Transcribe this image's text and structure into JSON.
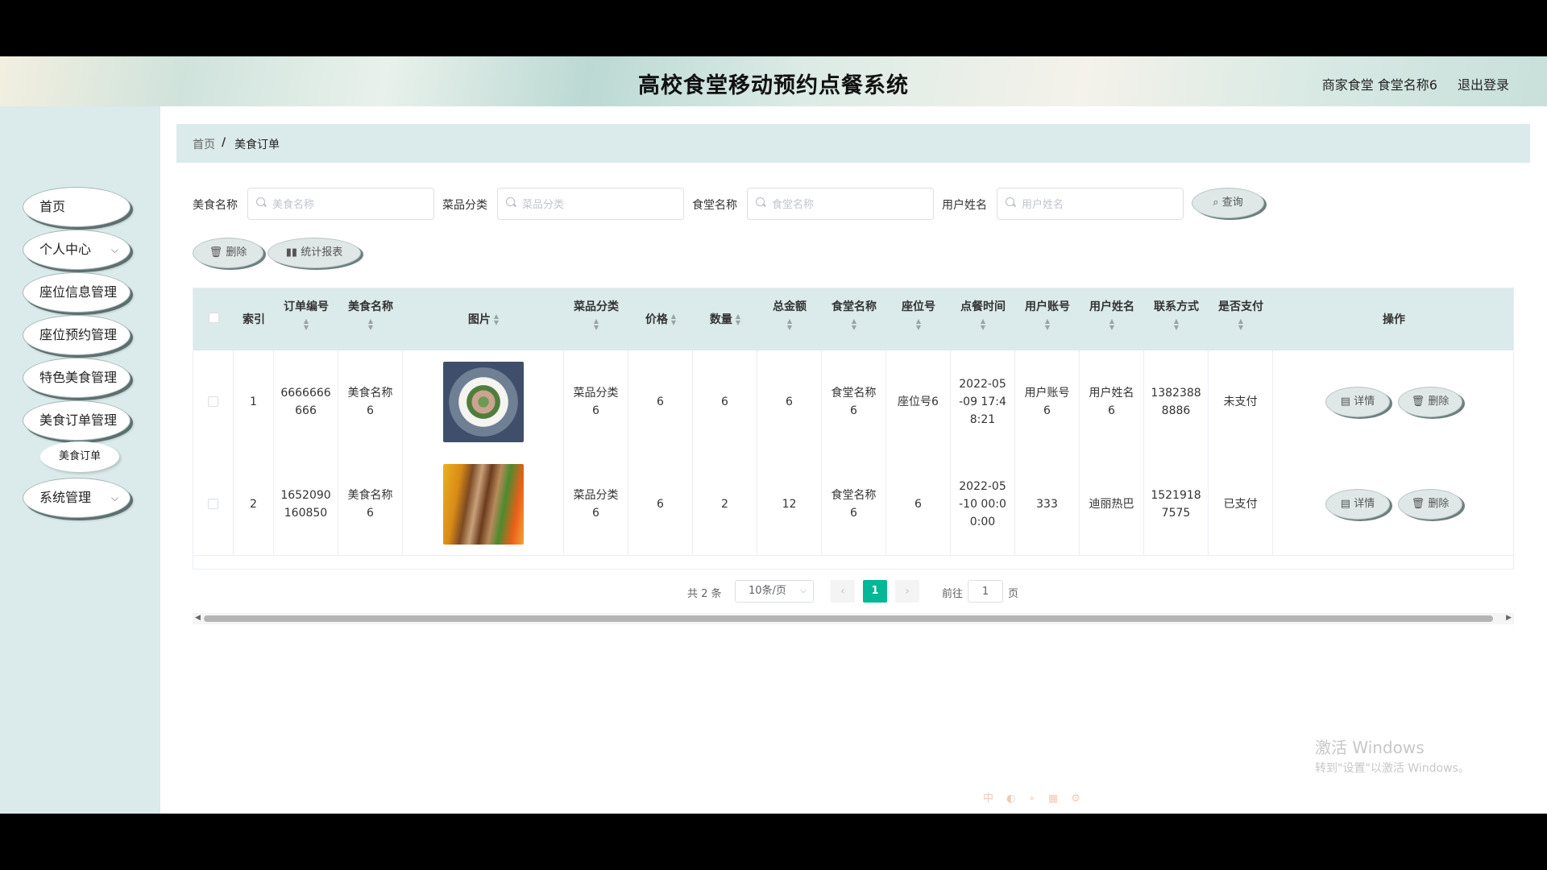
{
  "header": {
    "title": "高校食堂移动预约点餐系统",
    "user": "商家食堂 食堂名称6",
    "logout": "退出登录"
  },
  "sidebar": {
    "items": [
      {
        "label": "首页",
        "has_submenu": false
      },
      {
        "label": "个人中心",
        "has_submenu": true
      },
      {
        "label": "座位信息管理",
        "has_submenu": false
      },
      {
        "label": "座位预约管理",
        "has_submenu": false
      },
      {
        "label": "特色美食管理",
        "has_submenu": false
      },
      {
        "label": "美食订单管理",
        "has_submenu": false
      },
      {
        "label": "系统管理",
        "has_submenu": true
      }
    ],
    "submenu": [
      {
        "label": "美食订单"
      }
    ]
  },
  "breadcrumb": {
    "home": "首页",
    "separator": "/",
    "current": "美食订单"
  },
  "search": {
    "fields": [
      {
        "label": "美食名称",
        "placeholder": "美食名称",
        "value": ""
      },
      {
        "label": "菜品分类",
        "placeholder": "菜品分类",
        "value": ""
      },
      {
        "label": "食堂名称",
        "placeholder": "食堂名称",
        "value": ""
      },
      {
        "label": "用户姓名",
        "placeholder": "用户姓名",
        "value": ""
      }
    ],
    "query_button": "查询"
  },
  "actions": {
    "delete": "删除",
    "report": "统计报表"
  },
  "table": {
    "headers": [
      "索引",
      "订单编号",
      "美食名称",
      "图片",
      "菜品分类",
      "价格",
      "数量",
      "总金额",
      "食堂名称",
      "座位号",
      "点餐时间",
      "用户账号",
      "用户姓名",
      "联系方式",
      "是否支付",
      "操作"
    ],
    "rows": [
      [
        "1",
        "6666666666",
        "美食名称6",
        "",
        "菜品分类6",
        "6",
        "6",
        "6",
        "食堂名称6",
        "座位号6",
        "2022-05-09 17:48:21",
        "用户账号6",
        "用户姓名6",
        "13823888886",
        "未支付"
      ],
      [
        "2",
        "1652090160850",
        "美食名称6",
        "",
        "菜品分类6",
        "6",
        "2",
        "12",
        "食堂名称6",
        "6",
        "2022-05-10 00:00:00",
        "333",
        "迪丽热巴",
        "15219187575",
        "已支付"
      ]
    ],
    "row_actions": {
      "detail": "详情",
      "delete": "删除"
    }
  },
  "pagination": {
    "total": "共 2 条",
    "page_size": "10条/页",
    "current_page": "1",
    "goto_prefix": "前往",
    "goto_value": "1",
    "goto_suffix": "页"
  },
  "watermark": {
    "line1": "激活 Windows",
    "line2": "转到\"设置\"以激活 Windows。"
  },
  "colors": {
    "accent": "#00b895",
    "panel": "#dbeaea"
  }
}
